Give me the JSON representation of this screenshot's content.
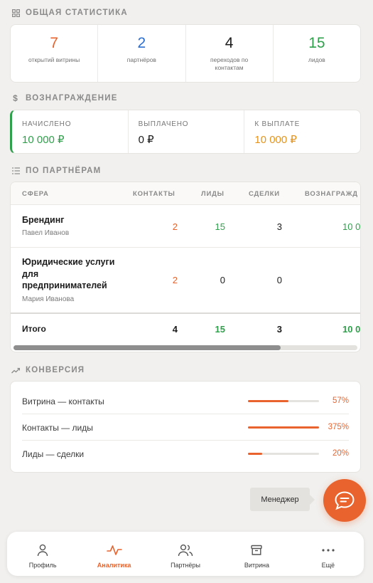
{
  "sections": {
    "stats_title": "Общая статистика",
    "reward_title": "Вознаграждение",
    "partners_title": "По партнёрам",
    "conversion_title": "Конверсия"
  },
  "stats": [
    {
      "value": "7",
      "label": "открытий витрины",
      "color": "#e8632d"
    },
    {
      "value": "2",
      "label": "партнёров",
      "color": "#2d6fd1"
    },
    {
      "value": "4",
      "label": "переходов по контактам",
      "color": "#1c1c1c"
    },
    {
      "value": "15",
      "label": "лидов",
      "color": "#2fa04b"
    }
  ],
  "reward": [
    {
      "label": "Начислено",
      "value": "10 000 ₽",
      "color": "#2fa04b"
    },
    {
      "label": "Выплачено",
      "value": "0 ₽",
      "color": "#1c1c1c"
    },
    {
      "label": "К выплате",
      "value": "10 000 ₽",
      "color": "#e3941f"
    }
  ],
  "partners_table": {
    "headers": {
      "sphere": "Сфера",
      "contacts": "Контакты",
      "leads": "Лиды",
      "deals": "Сделки",
      "reward": "Вознагражд"
    },
    "rows": [
      {
        "name": "Брендинг",
        "person": "Павел Иванов",
        "contacts": "2",
        "leads": "15",
        "deals": "3",
        "reward": "10 0"
      },
      {
        "name": "Юридические услуги для предпринимателей",
        "person": "Мария Иванова",
        "contacts": "2",
        "leads": "0",
        "deals": "0",
        "reward": ""
      }
    ],
    "total": {
      "label": "Итого",
      "contacts": "4",
      "leads": "15",
      "deals": "3",
      "reward": "10 0"
    }
  },
  "conversion": [
    {
      "label": "Витрина — контакты",
      "percent": "57%",
      "fill": 0.57
    },
    {
      "label": "Контакты — лиды",
      "percent": "375%",
      "fill": 1.0
    },
    {
      "label": "Лиды — сделки",
      "percent": "20%",
      "fill": 0.2
    }
  ],
  "manager": {
    "label": "Менеджер"
  },
  "nav": [
    {
      "label": "Профиль",
      "icon": "user-icon",
      "active": false
    },
    {
      "label": "Аналитика",
      "icon": "activity-icon",
      "active": true
    },
    {
      "label": "Партнёры",
      "icon": "users-icon",
      "active": false
    },
    {
      "label": "Витрина",
      "icon": "storefront-icon",
      "active": false
    },
    {
      "label": "Ещё",
      "icon": "more-icon",
      "active": false
    }
  ],
  "colors": {
    "accent": "#e8632d",
    "green": "#2fa04b",
    "blue": "#2d6fd1",
    "amber": "#e3941f"
  }
}
